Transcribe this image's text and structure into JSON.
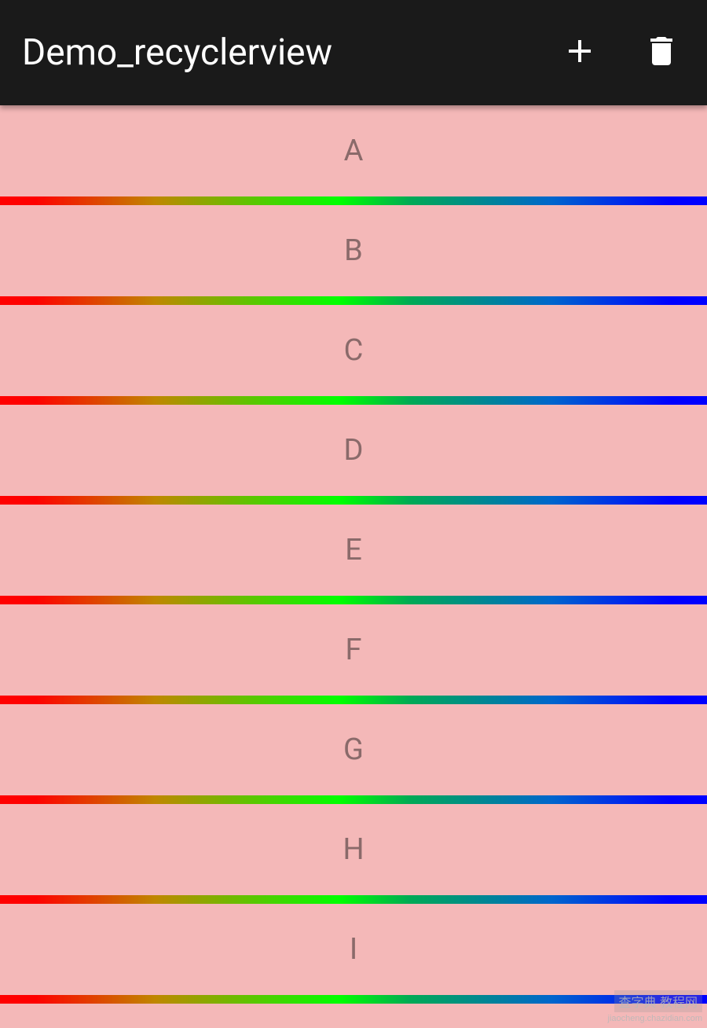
{
  "toolbar": {
    "title": "Demo_recyclerview",
    "actions": {
      "add_icon": "plus-icon",
      "delete_icon": "trash-icon"
    }
  },
  "list": {
    "items": [
      {
        "label": "A"
      },
      {
        "label": "B"
      },
      {
        "label": "C"
      },
      {
        "label": "D"
      },
      {
        "label": "E"
      },
      {
        "label": "F"
      },
      {
        "label": "G"
      },
      {
        "label": "H"
      },
      {
        "label": "I"
      }
    ]
  },
  "colors": {
    "toolbar_bg": "#1a1a1a",
    "item_bg": "#f4b8b8",
    "item_text": "#8a6a6a",
    "divider_gradient": [
      "#ff0000",
      "#00ff00",
      "#0000ff"
    ]
  },
  "watermark": {
    "line1": "查字典 教程网",
    "line2": "jiaocheng.chazidian.com"
  }
}
